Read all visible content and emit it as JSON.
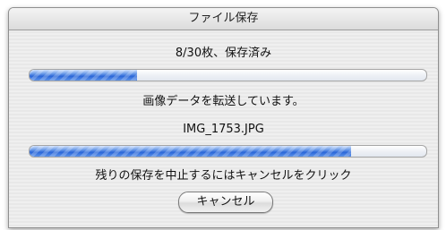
{
  "window": {
    "title": "ファイル保存"
  },
  "status": {
    "count_text": "8/30枚、保存済み",
    "overall_progress": 0.27,
    "transfer_text": "画像データを転送しています。",
    "filename": "IMG_1753.JPG",
    "file_progress": 0.81,
    "cancel_hint": "残りの保存を中止するにはキャンセルをクリック"
  },
  "buttons": {
    "cancel_label": "キャンセル"
  },
  "colors": {
    "progress_fill": "#2a66d8",
    "window_bg": "#ececec"
  }
}
